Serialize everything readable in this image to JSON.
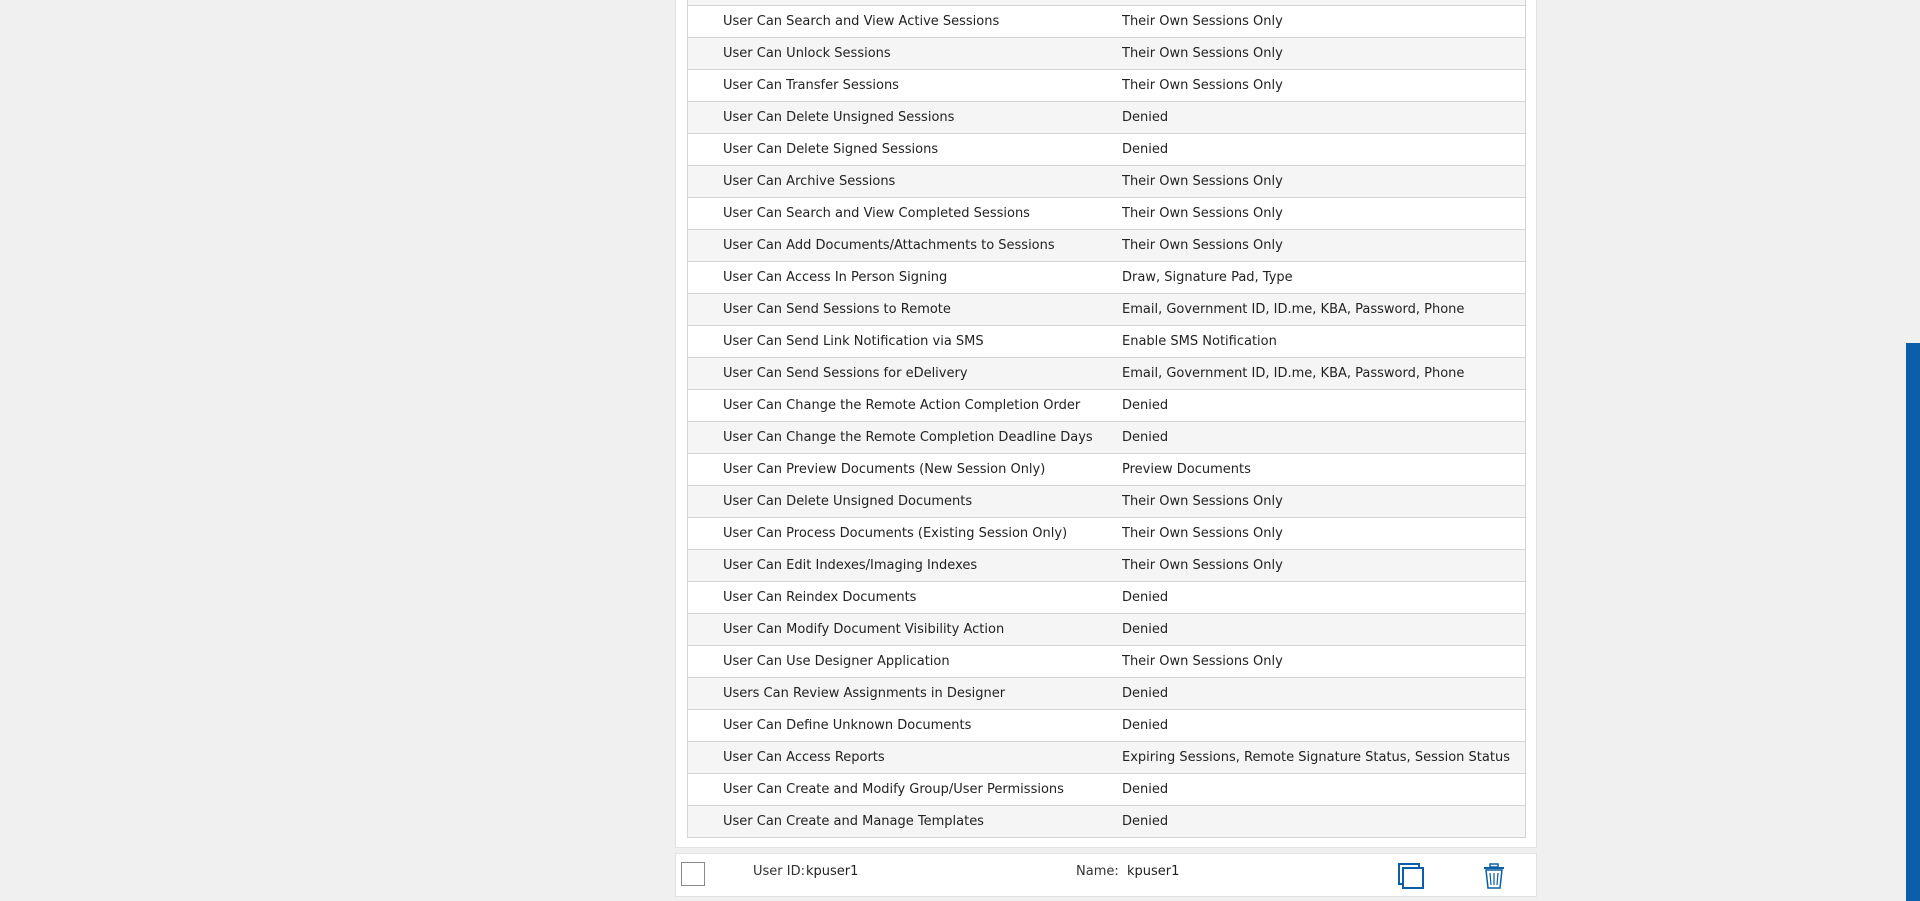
{
  "permissions": [
    {
      "name": "",
      "value": ""
    },
    {
      "name": "User Can Search and View Active Sessions",
      "value": "Their Own Sessions Only"
    },
    {
      "name": "User Can Unlock Sessions",
      "value": "Their Own Sessions Only"
    },
    {
      "name": "User Can Transfer Sessions",
      "value": "Their Own Sessions Only"
    },
    {
      "name": "User Can Delete Unsigned Sessions",
      "value": "Denied"
    },
    {
      "name": "User Can Delete Signed Sessions",
      "value": "Denied"
    },
    {
      "name": "User Can Archive Sessions",
      "value": "Their Own Sessions Only"
    },
    {
      "name": "User Can Search and View Completed Sessions",
      "value": "Their Own Sessions Only"
    },
    {
      "name": "User Can Add Documents/Attachments to Sessions",
      "value": "Their Own Sessions Only"
    },
    {
      "name": "User Can Access In Person Signing",
      "value": "Draw, Signature Pad, Type"
    },
    {
      "name": "User Can Send Sessions to Remote",
      "value": "Email, Government ID, ID.me, KBA, Password, Phone"
    },
    {
      "name": "User Can Send Link Notification via SMS",
      "value": "Enable SMS Notification"
    },
    {
      "name": "User Can Send Sessions for eDelivery",
      "value": "Email, Government ID, ID.me, KBA, Password, Phone"
    },
    {
      "name": "User Can Change the Remote Action Completion Order",
      "value": "Denied"
    },
    {
      "name": "User Can Change the Remote Completion Deadline Days",
      "value": "Denied"
    },
    {
      "name": "User Can Preview Documents (New Session Only)",
      "value": "Preview Documents"
    },
    {
      "name": "User Can Delete Unsigned Documents",
      "value": "Their Own Sessions Only"
    },
    {
      "name": "User Can Process Documents (Existing Session Only)",
      "value": "Their Own Sessions Only"
    },
    {
      "name": "User Can Edit Indexes/Imaging Indexes",
      "value": "Their Own Sessions Only"
    },
    {
      "name": "User Can Reindex Documents",
      "value": "Denied"
    },
    {
      "name": "User Can Modify Document Visibility Action",
      "value": "Denied"
    },
    {
      "name": "User Can Use Designer Application",
      "value": "Their Own Sessions Only"
    },
    {
      "name": "Users Can Review Assignments in Designer",
      "value": "Denied"
    },
    {
      "name": "User Can Define Unknown Documents",
      "value": "Denied"
    },
    {
      "name": "User Can Access Reports",
      "value": "Expiring Sessions, Remote Signature Status, Session Status"
    },
    {
      "name": "User Can Create and Modify Group/User Permissions",
      "value": "Denied"
    },
    {
      "name": "User Can Create and Manage Templates",
      "value": "Denied"
    }
  ],
  "user_card": {
    "user_id_label": "User ID:",
    "user_id_value": "kpuser1",
    "name_label": "Name:",
    "name_value": "kpuser1",
    "copy_icon": "copy-icon",
    "delete_icon": "trash-icon"
  },
  "colors": {
    "accent": "#0b5ea8",
    "row_odd": "#f5f5f5",
    "row_even": "#ffffff",
    "page_bg": "#f0f0f0"
  }
}
